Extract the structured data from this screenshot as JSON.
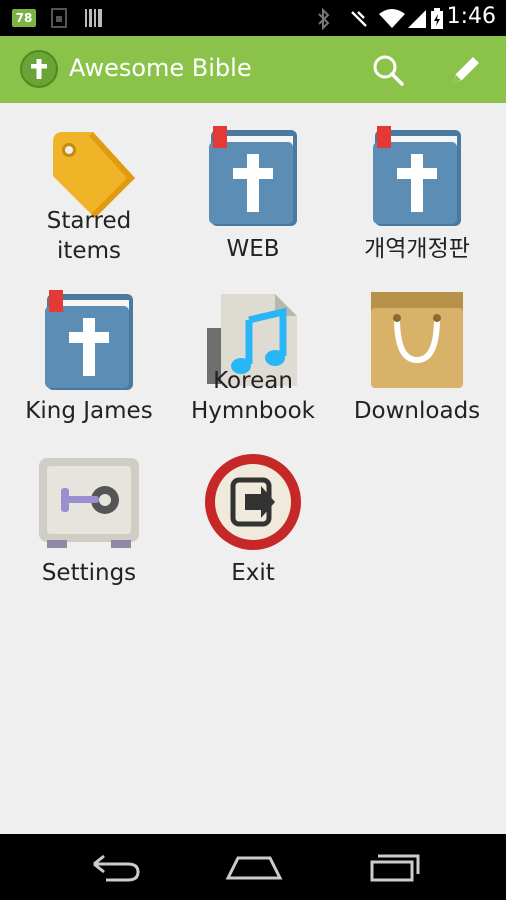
{
  "status_bar": {
    "badge": "78",
    "time": "1:46"
  },
  "action_bar": {
    "title": "Awesome Bible",
    "search_icon": "search-icon",
    "edit_icon": "pencil-icon"
  },
  "grid": {
    "items": [
      {
        "label": "Starred\nitems",
        "label_line1": "Starred",
        "label_line2": "items",
        "icon": "tag-icon"
      },
      {
        "label": "WEB",
        "icon": "bible-icon"
      },
      {
        "label": "개역개정판",
        "icon": "bible-icon"
      },
      {
        "label": "King James",
        "icon": "bible-icon"
      },
      {
        "label_line1": "Korean",
        "label_line2": "Hymnbook",
        "icon": "music-book-icon"
      },
      {
        "label": "Downloads",
        "icon": "shopping-bag-icon"
      },
      {
        "label": "Settings",
        "icon": "safe-icon"
      },
      {
        "label": "Exit",
        "icon": "exit-icon"
      }
    ]
  },
  "colors": {
    "action_bar": "#8bc34a",
    "background": "#efefef",
    "book_blue": "#5b8db5",
    "bookmark_red": "#e53935"
  }
}
